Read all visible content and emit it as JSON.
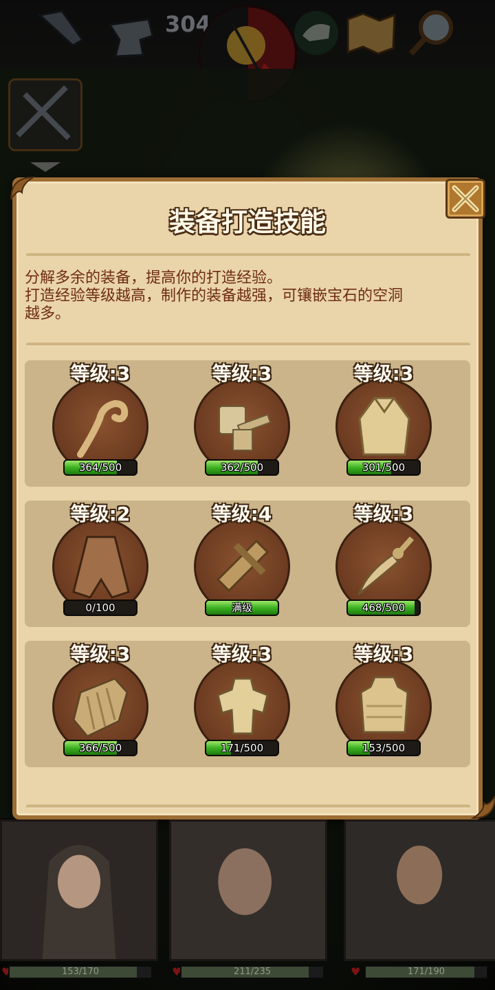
{
  "hud": {
    "counter": "304",
    "icons": [
      "fire-tongs-icon",
      "anvil-icon",
      "day-night-compass-icon",
      "dino-skull-icon",
      "treasure-map-icon",
      "magnifier-icon"
    ]
  },
  "dialog": {
    "title": "装备打造技能",
    "description_lines": [
      "分解多余的装备，提高你的打造经验。",
      "打造经验等级越高，制作的装备越强，可镶嵌宝石的空洞",
      "越多。"
    ],
    "skills": [
      {
        "level": "等级:3",
        "progress": "364/500",
        "fill": 0.728,
        "icon": "staff-icon"
      },
      {
        "level": "等级:3",
        "progress": "362/500",
        "fill": 0.724,
        "icon": "hammer-icon"
      },
      {
        "level": "等级:3",
        "progress": "301/500",
        "fill": 0.602,
        "icon": "cloak-icon"
      },
      {
        "level": "等级:2",
        "progress": "0/100",
        "fill": 0.0,
        "icon": "cape-icon"
      },
      {
        "level": "等级:4",
        "progress": "满级",
        "fill": 1.0,
        "icon": "crossbow-icon"
      },
      {
        "level": "等级:3",
        "progress": "468/500",
        "fill": 0.936,
        "icon": "sword-icon"
      },
      {
        "level": "等级:3",
        "progress": "366/500",
        "fill": 0.732,
        "icon": "shield-icon"
      },
      {
        "level": "等级:3",
        "progress": "171/500",
        "fill": 0.342,
        "icon": "plate-armor-icon"
      },
      {
        "level": "等级:3",
        "progress": "153/500",
        "fill": 0.306,
        "icon": "leather-vest-icon"
      }
    ]
  },
  "party": [
    {
      "hp": "153/170",
      "fill": 0.9
    },
    {
      "hp": "211/235",
      "fill": 0.9
    },
    {
      "hp": "171/190",
      "fill": 0.9
    }
  ]
}
